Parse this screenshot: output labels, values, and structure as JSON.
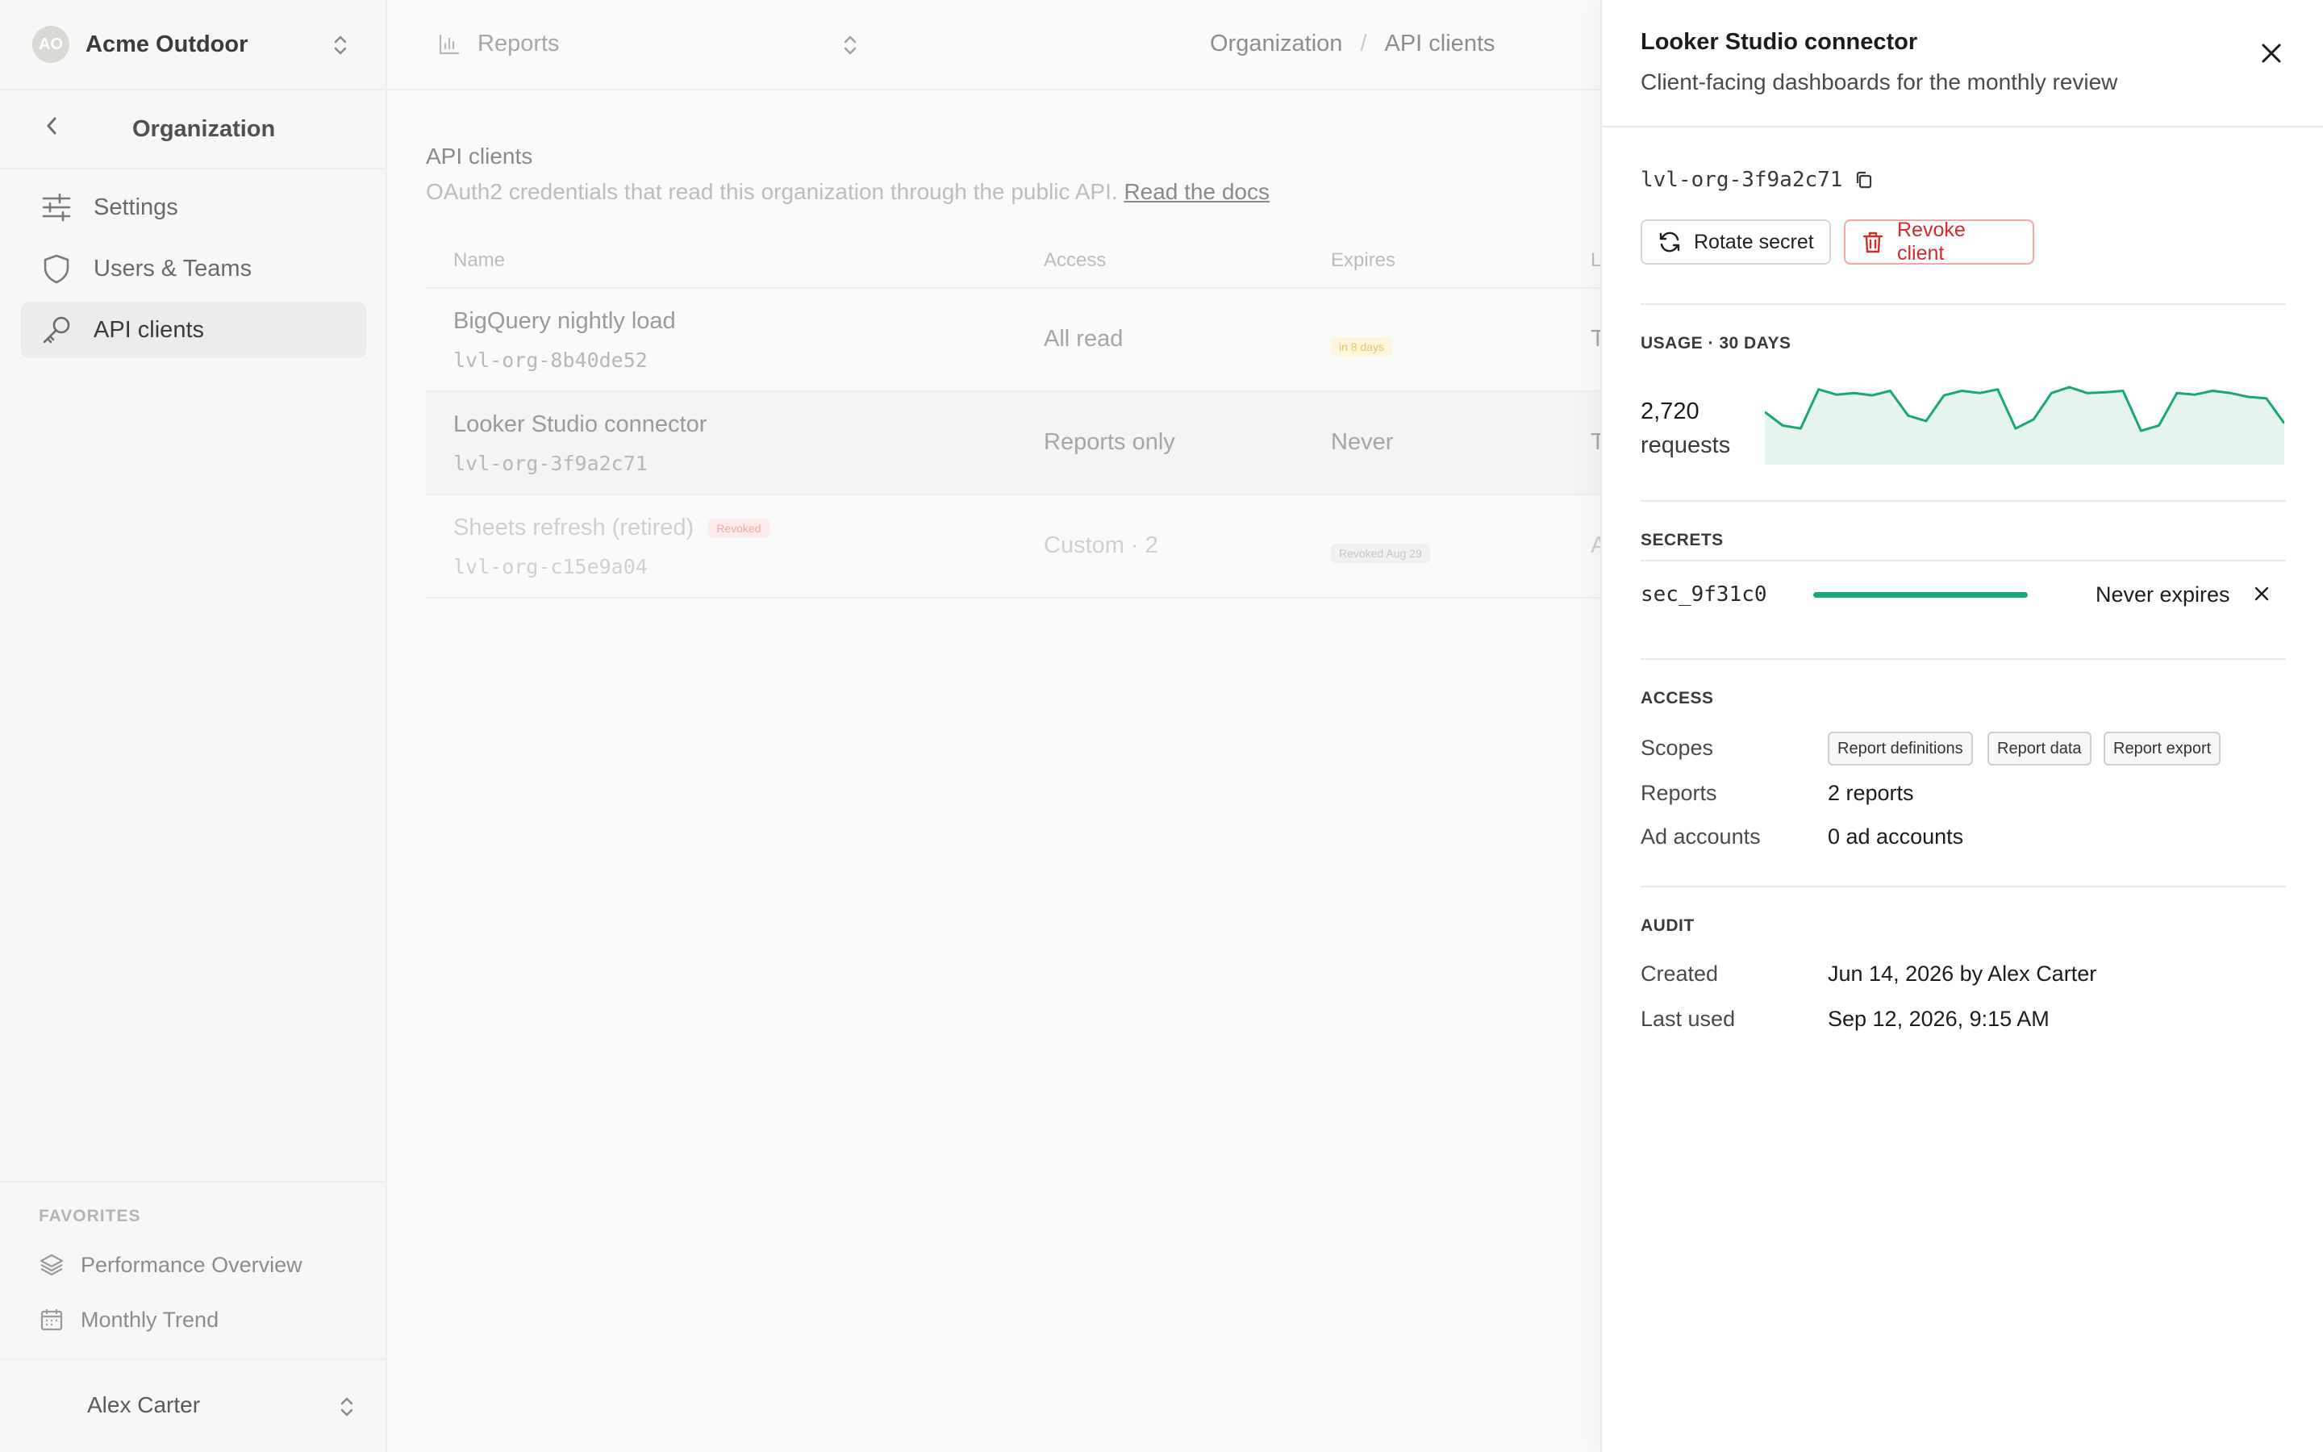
{
  "sidebar": {
    "org_initials": "AO",
    "org_name": "Acme Outdoor",
    "section_title": "Organization",
    "nav": [
      {
        "label": "Settings",
        "icon": "sliders-icon"
      },
      {
        "label": "Users & Teams",
        "icon": "shield-icon"
      },
      {
        "label": "API clients",
        "icon": "key-icon"
      }
    ],
    "favorites_heading": "FAVORITES",
    "favorites": [
      {
        "label": "Performance Overview",
        "icon": "layers-icon"
      },
      {
        "label": "Monthly Trend",
        "icon": "calendar-icon"
      }
    ],
    "user_name": "Alex Carter"
  },
  "topbar": {
    "report_selector": "Reports",
    "breadcrumb": [
      "Organization",
      "API clients"
    ]
  },
  "page": {
    "title": "API clients",
    "subtitle": "OAuth2 credentials that read this organization through the public API.",
    "docs_link": "Read the docs"
  },
  "table": {
    "headers": [
      "Name",
      "Access",
      "Expires",
      "L"
    ],
    "rows": [
      {
        "name": "BigQuery nightly load",
        "id": "lvl-org-8b40de52",
        "access": "All read",
        "expires": "in 8 days",
        "last": "T"
      },
      {
        "name": "Looker Studio connector",
        "id": "lvl-org-3f9a2c71",
        "access": "Reports only",
        "expires": "Never",
        "last": "T"
      },
      {
        "name": "Sheets refresh (retired)",
        "badge": "Revoked",
        "id": "lvl-org-c15e9a04",
        "access": "Custom · 2",
        "expires": "Revoked Aug 29",
        "last": "A"
      }
    ]
  },
  "drawer": {
    "title": "Looker Studio connector",
    "subtitle": "Client-facing dashboards for the monthly review",
    "client_id": "lvl-org-3f9a2c71",
    "rotate_label": "Rotate secret",
    "revoke_label": "Revoke client",
    "usage_heading": "USAGE · 30 DAYS",
    "usage_count": "2,720",
    "usage_unit": "requests",
    "secrets_heading": "SECRETS",
    "secret": {
      "id": "sec_9f31c0",
      "expiry": "Never expires",
      "remaining_fraction": 1.0
    },
    "access_heading": "ACCESS",
    "access": {
      "scopes_label": "Scopes",
      "scopes": [
        "Report definitions",
        "Report data",
        "Report export"
      ],
      "reports_label": "Reports",
      "reports_value": "2 reports",
      "ad_accounts_label": "Ad accounts",
      "ad_accounts_value": "0 ad accounts"
    },
    "audit_heading": "AUDIT",
    "audit": {
      "created_label": "Created",
      "created_value": "Jun 14, 2026 by Alex Carter",
      "last_used_label": "Last used",
      "last_used_value": "Sep 12, 2026, 9:15 AM"
    },
    "accent_color": "#1aa872",
    "danger_color": "#d42a2a"
  },
  "chart_data": {
    "type": "area",
    "title": "",
    "xlabel": "",
    "ylabel": "",
    "x": [
      1,
      2,
      3,
      4,
      5,
      6,
      7,
      8,
      9,
      10,
      11,
      12,
      13,
      14,
      15,
      16,
      17,
      18,
      19,
      20,
      21,
      22,
      23,
      24,
      25,
      26,
      27,
      28,
      29,
      30
    ],
    "values": [
      70,
      52,
      48,
      100,
      93,
      95,
      92,
      98,
      65,
      58,
      92,
      98,
      95,
      100,
      48,
      60,
      95,
      103,
      95,
      96,
      98,
      45,
      52,
      95,
      93,
      98,
      95,
      90,
      88,
      55
    ],
    "ylim": [
      0,
      120
    ],
    "color": "#1aa872"
  }
}
